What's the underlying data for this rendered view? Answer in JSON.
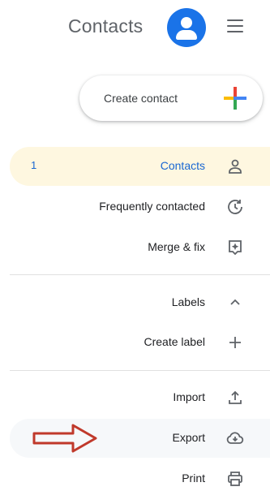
{
  "header": {
    "app_title": "Contacts",
    "menu_icon": "hamburger-menu-icon",
    "avatar_icon": "account-avatar-icon",
    "accent": "#1a73e8"
  },
  "create_contact": {
    "label": "Create contact",
    "icon": "colored-plus-icon"
  },
  "nav": {
    "contacts": {
      "label": "Contacts",
      "count": "1",
      "icon": "person-icon"
    },
    "frequent": {
      "label": "Frequently contacted",
      "icon": "history-icon"
    },
    "merge": {
      "label": "Merge & fix",
      "icon": "merge-fix-icon"
    }
  },
  "labels": {
    "header": "Labels",
    "create_label": "Create label"
  },
  "actions": {
    "import": "Import",
    "export": "Export",
    "print": "Print"
  },
  "annotation": {
    "arrow_color": "#c0392b"
  }
}
